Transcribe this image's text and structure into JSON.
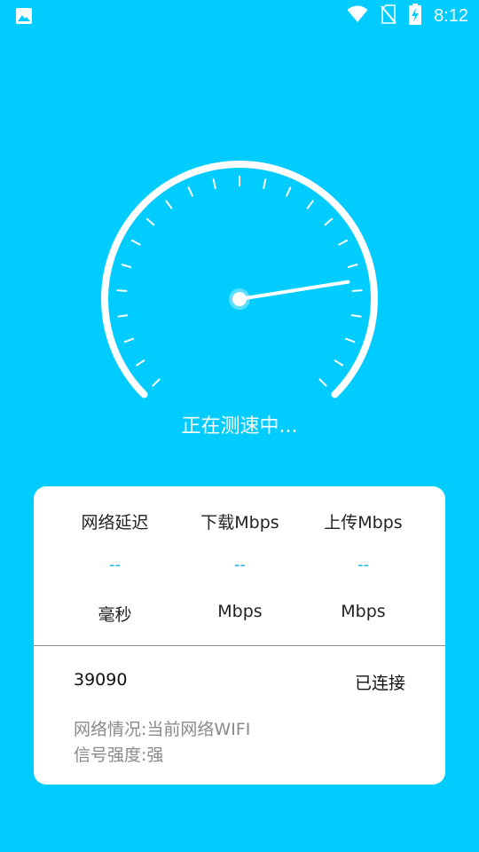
{
  "status_bar": {
    "time": "8:12",
    "icons": [
      "image-icon",
      "wifi-icon",
      "no-sim-icon",
      "battery-charging-icon"
    ]
  },
  "speed_test": {
    "status_text": "正在测速中...",
    "gauge_level_fraction": 0.8
  },
  "metrics": [
    {
      "title": "网络延迟",
      "value": "--",
      "unit": "毫秒"
    },
    {
      "title": "下载Mbps",
      "value": "--",
      "unit": "Mbps"
    },
    {
      "title": "上传Mbps",
      "value": "--",
      "unit": "Mbps"
    }
  ],
  "info": {
    "port": "39090",
    "connection_status": "已连接",
    "network_status": "网络情况:当前网络WIFI",
    "signal_strength": "信号强度:强"
  },
  "colors": {
    "background": "#00CCFF",
    "card": "#FFFFFF",
    "value_accent": "#16B8F0"
  }
}
